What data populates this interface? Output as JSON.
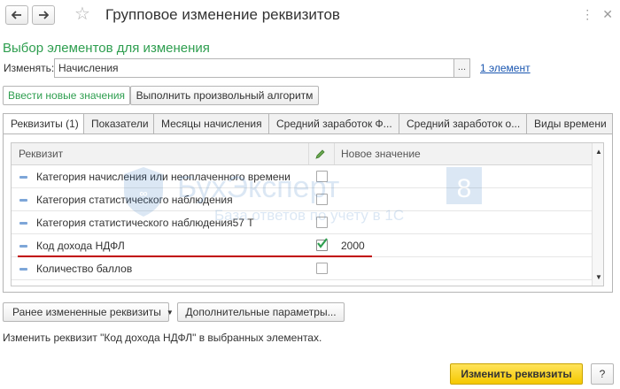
{
  "window": {
    "title": "Групповое изменение реквизитов"
  },
  "header": {
    "section_title": "Выбор элементов для изменения",
    "change_label": "Изменять:",
    "change_value": "Начисления",
    "select_button": "...",
    "count_link": "1 элемент"
  },
  "mode_buttons": {
    "new_values": "Ввести новые значения",
    "algorithm": "Выполнить произвольный алгоритм"
  },
  "tabs": [
    {
      "label": "Реквизиты (1)"
    },
    {
      "label": "Показатели"
    },
    {
      "label": "Месяцы начисления"
    },
    {
      "label": "Средний заработок Ф..."
    },
    {
      "label": "Средний заработок о..."
    },
    {
      "label": "Виды времени"
    }
  ],
  "table": {
    "columns": {
      "attribute": "Реквизит",
      "new_value": "Новое значение"
    },
    "rows": [
      {
        "name": "Категория начисления или неоплаченного времени",
        "checked": false,
        "value": ""
      },
      {
        "name": "Категория статистического наблюдения",
        "checked": false,
        "value": ""
      },
      {
        "name": "Категория статистического наблюдения57 Т",
        "checked": false,
        "value": ""
      },
      {
        "name": "Код дохода НДФЛ",
        "checked": true,
        "value": "2000"
      },
      {
        "name": "Количество баллов",
        "checked": false,
        "value": ""
      }
    ]
  },
  "watermark": {
    "brand": "БухЭксперт",
    "number": "8",
    "tagline": "База ответов по учету в 1С"
  },
  "footer": {
    "changed_attrs_button": "Ранее измененные реквизиты",
    "extra_params_button": "Дополнительные параметры...",
    "hint": "Изменить реквизит \"Код дохода НДФЛ\" в выбранных элементах.",
    "submit_button": "Изменить реквизиты",
    "help_button": "?"
  },
  "colors": {
    "accent_green": "#2e9e4f",
    "link_blue": "#1a56b0",
    "primary_yellow": "#f5c800",
    "highlight_red": "#c00000"
  }
}
